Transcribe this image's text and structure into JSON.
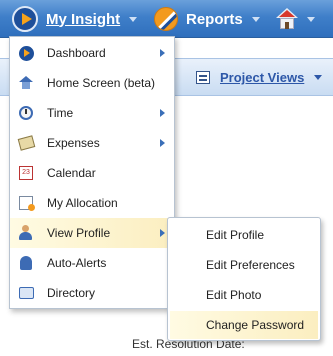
{
  "topnav": {
    "my_insight": "My Insight",
    "reports": "Reports"
  },
  "subnav": {
    "project_views": "Project Views"
  },
  "main": {
    "est_resolution_label": "Est. Resolution Date:"
  },
  "menu": {
    "items": [
      {
        "label": "Dashboard",
        "icon": "dashboard-icon",
        "has_submenu": true
      },
      {
        "label": "Home Screen (beta)",
        "icon": "home-icon",
        "has_submenu": false
      },
      {
        "label": "Time",
        "icon": "clock-icon",
        "has_submenu": true
      },
      {
        "label": "Expenses",
        "icon": "expenses-icon",
        "has_submenu": true
      },
      {
        "label": "Calendar",
        "icon": "calendar-icon",
        "has_submenu": false
      },
      {
        "label": "My Allocation",
        "icon": "allocation-icon",
        "has_submenu": false
      },
      {
        "label": "View Profile",
        "icon": "profile-icon",
        "has_submenu": true,
        "active": true
      },
      {
        "label": "Auto-Alerts",
        "icon": "bell-icon",
        "has_submenu": false
      },
      {
        "label": "Directory",
        "icon": "directory-icon",
        "has_submenu": false
      }
    ],
    "calendar_icon_text": "23"
  },
  "submenu": {
    "items": [
      {
        "label": "Edit Profile"
      },
      {
        "label": "Edit Preferences"
      },
      {
        "label": "Edit Photo"
      },
      {
        "label": "Change Password",
        "active": true
      }
    ]
  },
  "colors": {
    "topbar": "#3f7fc9",
    "accent_orange": "#f7a21b",
    "highlight": "#fbeec0"
  }
}
